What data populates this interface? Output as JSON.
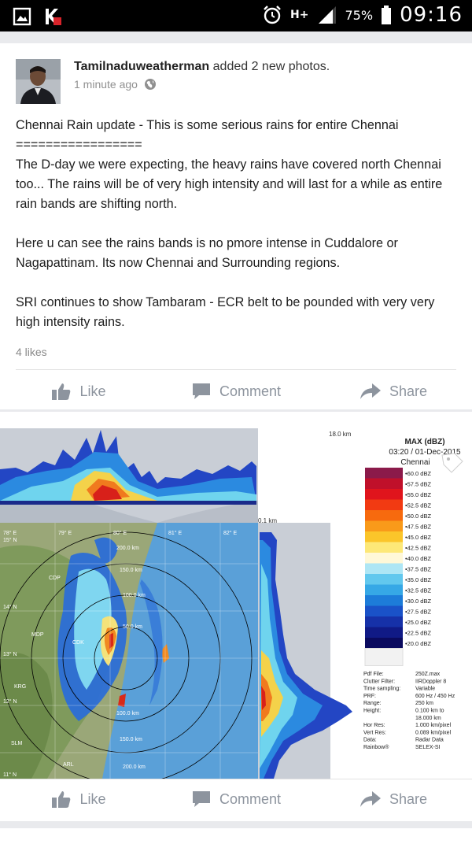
{
  "statusbar": {
    "network": "H+",
    "battery": "75%",
    "time": "09:16"
  },
  "post": {
    "author": "Tamilnaduweatherman",
    "action": "added 2 new photos.",
    "time": "1 minute ago",
    "paragraphs": [
      "Chennai Rain update - This is some serious rains for entire Chennai\n=================\nThe D-day we were expecting, the heavy rains have covered north Chennai too... The rains will be of very high intensity and will last for a while as entire rain bands are shifting north.",
      "Here u can see the rains bands is no pmore intense in Cuddalore or Nagapattinam. Its now Chennai and Surrounding regions.",
      "SRI continues to show Tambaram - ECR belt to be pounded with very very high intensity rains."
    ],
    "likes": "4 likes"
  },
  "actions": {
    "like": "Like",
    "comment": "Comment",
    "share": "Share"
  },
  "radar": {
    "title": "MAX (dBZ)",
    "timestamp": "03:20 / 01-Dec-2015",
    "station": "Chennai",
    "height_top": "18.0 km",
    "height_bottom": "0.1 km",
    "legend": [
      "60.0 dBZ",
      "57.5 dBZ",
      "55.0 dBZ",
      "52.5 dBZ",
      "50.0 dBZ",
      "47.5 dBZ",
      "45.0 dBZ",
      "42.5 dBZ",
      "40.0 dBZ",
      "37.5 dBZ",
      "35.0 dBZ",
      "32.5 dBZ",
      "30.0 dBZ",
      "27.5 dBZ",
      "25.0 dBZ",
      "22.5 dBZ",
      "20.0 dBZ"
    ],
    "legend_colors": [
      "#8b1a4a",
      "#c0102a",
      "#e0141c",
      "#f23a12",
      "#f76a0e",
      "#f99a1a",
      "#fbc52a",
      "#fde878",
      "#fff8d8",
      "#aee6f5",
      "#62c8ee",
      "#36a8e6",
      "#1d7cd9",
      "#1a52c8",
      "#1631a8",
      "#101a86",
      "#0a0a5e"
    ],
    "map_labels": {
      "lon": [
        "78° E",
        "79° E",
        "80° E",
        "81° E",
        "82° E"
      ],
      "lat": [
        "15° N",
        "14° N",
        "13° N",
        "12° N",
        "11° N"
      ],
      "ranges": [
        "200.0 km",
        "150.0 km",
        "100.0 km",
        "50.0 km",
        "100.0 km",
        "150.0 km",
        "200.0 km"
      ],
      "places": [
        "CDP",
        "MDP",
        "KRG",
        "SLM",
        "ARL",
        "CDK"
      ]
    },
    "info": [
      {
        "k": "Pdf File:",
        "v": "250Z.max"
      },
      {
        "k": "Clutter Filter:",
        "v": "IIRDoppler 8"
      },
      {
        "k": "Time sampling:",
        "v": "Variable"
      },
      {
        "k": "PRF:",
        "v": "600 Hz / 450 Hz"
      },
      {
        "k": "Range:",
        "v": "250 km"
      },
      {
        "k": "Height:",
        "v": "0.100 km to"
      },
      {
        "k": "",
        "v": "18.000 km"
      },
      {
        "k": "Hor Res:",
        "v": "1.000 km/pixel"
      },
      {
        "k": "Vert Res:",
        "v": "0.089 km/pixel"
      },
      {
        "k": "Data:",
        "v": "Radar Data"
      },
      {
        "k": "Rainbow®",
        "v": "SELEX-SI"
      }
    ]
  }
}
